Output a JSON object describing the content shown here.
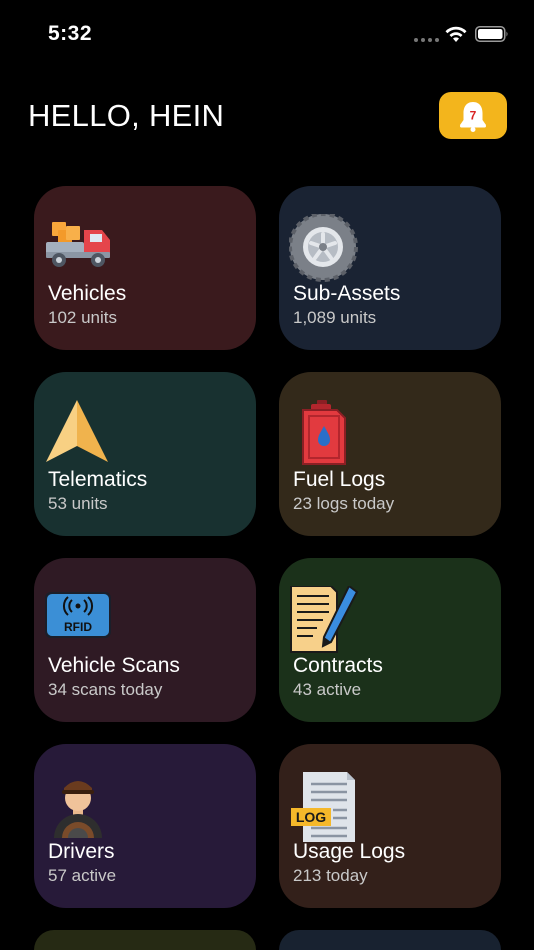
{
  "status_bar": {
    "time": "5:32"
  },
  "header": {
    "greeting": "HELLO, HEIN",
    "notification_count": "7"
  },
  "tiles": [
    {
      "label": "Vehicles",
      "sub": "102 units",
      "icon": "truck-icon",
      "color": "#3a1a1d"
    },
    {
      "label": "Sub-Assets",
      "sub": "1,089 units",
      "icon": "tire-icon",
      "color": "#1a2333"
    },
    {
      "label": "Telematics",
      "sub": "53 units",
      "icon": "navigation-arrow-icon",
      "color": "#183130"
    },
    {
      "label": "Fuel Logs",
      "sub": "23 logs today",
      "icon": "jerrycan-icon",
      "color": "#33291a"
    },
    {
      "label": "Vehicle Scans",
      "sub": "34 scans today",
      "icon": "rfid-icon",
      "color": "#2f1a24"
    },
    {
      "label": "Contracts",
      "sub": "43 active",
      "icon": "contract-icon",
      "color": "#1b311a"
    },
    {
      "label": "Drivers",
      "sub": "57 active",
      "icon": "driver-icon",
      "color": "#271a39"
    },
    {
      "label": "Usage Logs",
      "sub": "213 today",
      "icon": "log-document-icon",
      "color": "#33201a"
    }
  ],
  "partial_tiles": [
    {
      "color": "#262a14"
    },
    {
      "color": "#182230"
    }
  ],
  "colors": {
    "accent": "#f3b51c",
    "background": "#000000"
  }
}
